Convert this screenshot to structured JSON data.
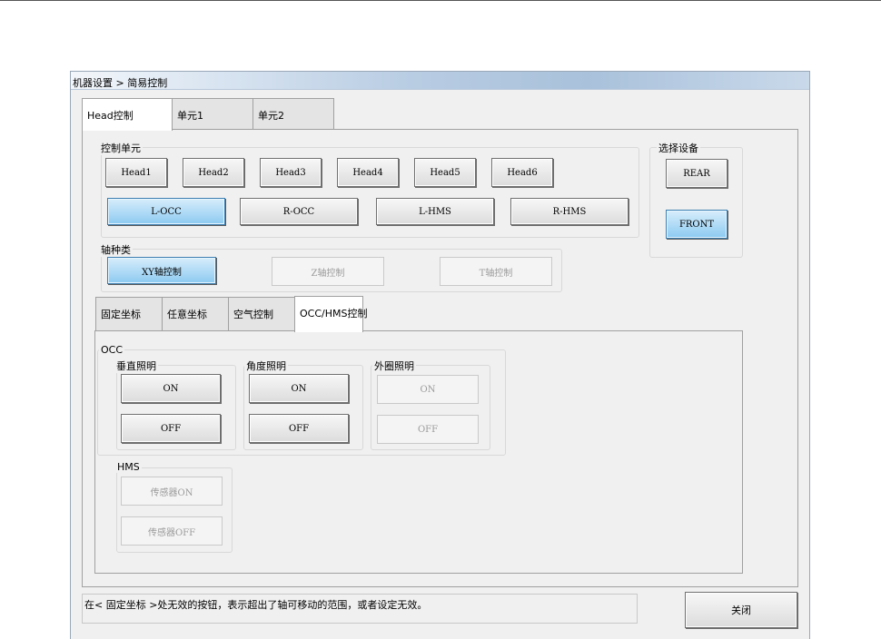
{
  "window": {
    "title": "机器设置 > 简易控制",
    "tabs": [
      "Head控制",
      "单元1",
      "单元2"
    ]
  },
  "control_unit": {
    "label": "控制单元",
    "heads": [
      "Head1",
      "Head2",
      "Head3",
      "Head4",
      "Head5",
      "Head6"
    ],
    "sides": [
      "L-OCC",
      "R-OCC",
      "L-HMS",
      "R-HMS"
    ]
  },
  "select_device": {
    "label": "选择设备",
    "rear": "REAR",
    "front": "FRONT"
  },
  "axis": {
    "label": "轴种类",
    "xy": "XY轴控制",
    "z": "Z轴控制",
    "t": "T轴控制"
  },
  "inner_tabs": [
    "固定坐标",
    "任意坐标",
    "空气控制",
    "OCC/HMS控制"
  ],
  "occ": {
    "label": "OCC",
    "vertical": {
      "label": "垂直照明",
      "on": "ON",
      "off": "OFF"
    },
    "angle": {
      "label": "角度照明",
      "on": "ON",
      "off": "OFF"
    },
    "outer": {
      "label": "外圈照明",
      "on": "ON",
      "off": "OFF"
    }
  },
  "hms": {
    "label": "HMS",
    "sensor_on": "传感器ON",
    "sensor_off": "传感器OFF"
  },
  "status_message": "在< 固定坐标 >处无效的按钮，表示超出了轴可移动的范围，或者设定无效。",
  "close_label": "关闭",
  "colors": {
    "active_button": "#8ccaf1",
    "window_bg": "#f0f0f0",
    "title_gradient": "#a9c1db"
  }
}
